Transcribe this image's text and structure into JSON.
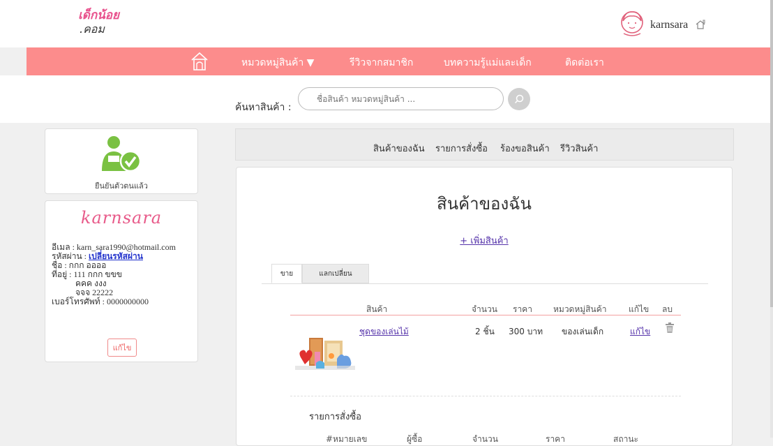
{
  "header": {
    "logo_line1": "เด็กน้อย",
    "logo_line2": ".คอม",
    "username": "karnsara"
  },
  "nav": {
    "items": [
      "หมวดหมู่สินค้า ▼",
      "รีวิวจากสมาชิก",
      "บทความรู้แม่และเด็ก",
      "ติดต่อเรา"
    ]
  },
  "search": {
    "label": "ค้นหาสินค้า :",
    "placeholder": "ชื่อสินค้า หมวดหมู่สินค้า ..."
  },
  "verify": {
    "text": "ยืนยันตัวตนแล้ว"
  },
  "profile": {
    "name": "karnsara",
    "email": "อีเมล : karn_sara1990@hotmail.com",
    "password_label": "รหัสผ่าน : ",
    "password_link": "เปลี่ยนรหัสผ่าน",
    "fullname": "ชื่อ : กกก  ออออ",
    "address_line1": "ที่อยู่ : 111 กกก ขขข",
    "address_line2": "คคค  งงง",
    "address_line3": "จจจ  22222",
    "phone": "เบอร์โทรศัพท์ : 0000000000",
    "edit_label": "แก้ไข"
  },
  "tabs": [
    "สินค้าของฉัน",
    "รายการสั่งซื้อ",
    "ร้องขอสินค้า",
    "รีวิวสินค้า"
  ],
  "main": {
    "title": "สินค้าของฉัน",
    "add_label": "+ เพิ่มสินค้า",
    "subtabs": [
      "ขาย",
      "แลกเปลี่ยน"
    ],
    "columns": [
      "สินค้า",
      "จำนวน",
      "ราคา",
      "หมวดหมู่สินค้า",
      "แก้ไข",
      "ลบ"
    ],
    "rows": [
      {
        "name": "ชุดของเล่นไม้",
        "qty": "2 ชิ้น",
        "price": "300 บาท",
        "category": "ของเล่นเด็ก",
        "edit": "แก้ไข"
      }
    ],
    "orders_title": "รายการสั่งซื้อ",
    "order_columns": [
      "#หมายเลข",
      "ผู้ซื้อ",
      "จำนวน",
      "ราคา",
      "สถานะ"
    ]
  },
  "colors": {
    "nav_bg": "#fc8c8c",
    "accent_pink": "#e85b8a",
    "link": "#5533aa"
  }
}
